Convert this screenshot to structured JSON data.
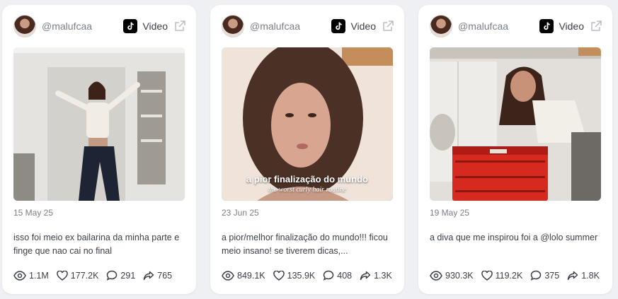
{
  "cards": [
    {
      "handle": "@malufcaa",
      "platform": "Video",
      "date": "15 May 25",
      "description": "isso foi meio ex bailarina da minha parte e finge que nao cai no final",
      "overlay_main": "",
      "overlay_sub": "",
      "stats": {
        "views": "1.1M",
        "likes": "177.2K",
        "comments": "291",
        "shares": "765"
      }
    },
    {
      "handle": "@malufcaa",
      "platform": "Video",
      "date": "23 Jun 25",
      "description": "a pior/melhor finalização do mundo!!! ficou meio insano! se tiverem dicas,...",
      "overlay_main": "a pior finalização do mundo",
      "overlay_sub": "the worst curly hair routine",
      "stats": {
        "views": "849.1K",
        "likes": "135.9K",
        "comments": "408",
        "shares": "1.3K"
      }
    },
    {
      "handle": "@malufcaa",
      "platform": "Video",
      "date": "19 May 25",
      "description": "a diva que me inspirou foi a @lolo summer",
      "overlay_main": "",
      "overlay_sub": "",
      "stats": {
        "views": "930.3K",
        "likes": "119.2K",
        "comments": "375",
        "shares": "1.8K"
      }
    }
  ],
  "icons": {
    "platform": "tiktok-icon",
    "external": "external-link-icon",
    "views": "eye-icon",
    "likes": "heart-icon",
    "comments": "comment-icon",
    "shares": "share-icon"
  }
}
